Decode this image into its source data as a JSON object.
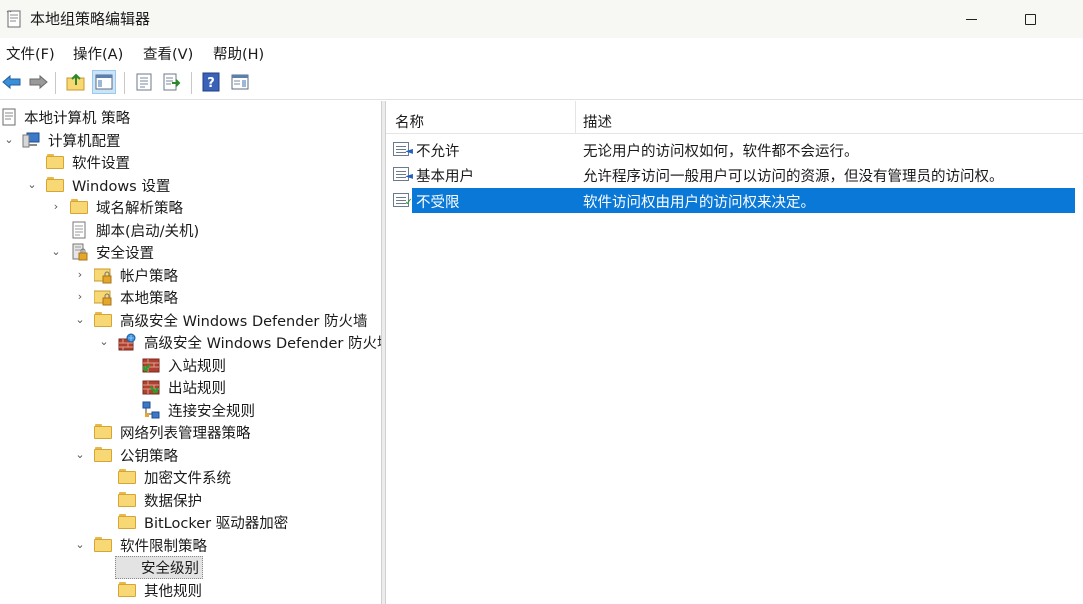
{
  "window": {
    "title": "本地组策略编辑器"
  },
  "menu": [
    {
      "label": "文件(F)"
    },
    {
      "label": "操作(A)"
    },
    {
      "label": "查看(V)"
    },
    {
      "label": "帮助(H)"
    }
  ],
  "toolbar": {
    "buttons": [
      "back-icon",
      "forward-icon",
      "up-folder-icon",
      "show-hide-console-tree-icon",
      "properties-icon",
      "export-list-icon",
      "help-icon",
      "show-action-pane-icon"
    ]
  },
  "tree": [
    {
      "label": "本地计算机 策略",
      "expanded": null,
      "icon": "policy-doc-icon"
    },
    {
      "label": "计算机配置",
      "expanded": true,
      "icon": "computer-icon"
    },
    {
      "label": "软件设置",
      "expanded": null,
      "icon": "folder-icon"
    },
    {
      "label": "Windows 设置",
      "expanded": true,
      "icon": "folder-icon"
    },
    {
      "label": "域名解析策略",
      "expanded": false,
      "icon": "folder-icon"
    },
    {
      "label": "脚本(启动/关机)",
      "expanded": null,
      "icon": "script-icon"
    },
    {
      "label": "安全设置",
      "expanded": true,
      "icon": "security-settings-icon"
    },
    {
      "label": "帐户策略",
      "expanded": false,
      "icon": "locked-folder-icon"
    },
    {
      "label": "本地策略",
      "expanded": false,
      "icon": "locked-folder-icon"
    },
    {
      "label": "高级安全 Windows Defender 防火墙",
      "expanded": true,
      "icon": "folder-icon"
    },
    {
      "label": "高级安全 Windows Defender 防火墙",
      "expanded": true,
      "icon": "firewall-icon"
    },
    {
      "label": "入站规则",
      "expanded": null,
      "icon": "inbound-rules-icon"
    },
    {
      "label": "出站规则",
      "expanded": null,
      "icon": "outbound-rules-icon"
    },
    {
      "label": "连接安全规则",
      "expanded": null,
      "icon": "connection-security-icon"
    },
    {
      "label": "网络列表管理器策略",
      "expanded": null,
      "icon": "folder-icon"
    },
    {
      "label": "公钥策略",
      "expanded": true,
      "icon": "folder-icon"
    },
    {
      "label": "加密文件系统",
      "expanded": null,
      "icon": "folder-icon"
    },
    {
      "label": "数据保护",
      "expanded": null,
      "icon": "folder-icon"
    },
    {
      "label": "BitLocker 驱动器加密",
      "expanded": null,
      "icon": "folder-icon"
    },
    {
      "label": "软件限制策略",
      "expanded": true,
      "icon": "folder-icon"
    },
    {
      "label": "安全级别",
      "expanded": null,
      "icon": "folder-icon",
      "selected": true
    },
    {
      "label": "其他规则",
      "expanded": null,
      "icon": "folder-icon"
    }
  ],
  "list": {
    "columns": [
      "名称",
      "描述"
    ],
    "rows": [
      {
        "name": "不允许",
        "desc": "无论用户的访问权如何，软件都不会运行。",
        "selected": false
      },
      {
        "name": "基本用户",
        "desc": "允许程序访问一般用户可以访问的资源，但没有管理员的访问权。",
        "selected": false
      },
      {
        "name": "不受限",
        "desc": "软件访问权由用户的访问权来决定。",
        "selected": true
      }
    ]
  },
  "colors": {
    "selection": "#0a78d7",
    "tree_selection": "#e3e3e3"
  }
}
